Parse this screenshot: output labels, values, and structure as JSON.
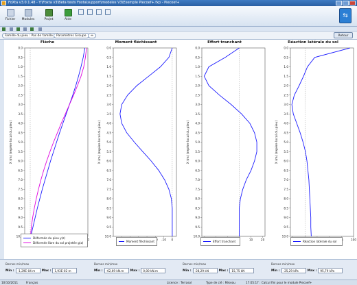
{
  "window": {
    "title": "FoXta v3.0.1.48 - Y:\\Foxta v3\\Beta tests Foxta\\support\\modeles V3\\Exemple Piecoef+.fxp - Piecoef+"
  },
  "ribbon": {
    "buttons": [
      {
        "label": "Fichier",
        "icon": "file-icon"
      },
      {
        "label": "Modules",
        "icon": "modules-icon"
      },
      {
        "label": "Projet",
        "icon": "project-icon"
      },
      {
        "label": "Aide",
        "icon": "help-icon"
      }
    ]
  },
  "toolbar": {
    "family_tag": "Famille du pieu : Pas de famille",
    "params_tag": "Paramètres Groupe",
    "back_label": "Retour"
  },
  "charts": {
    "depth_axis_label": "X (m) (repère local du pieu)",
    "depth_ticks": [
      "0.0",
      "0.5",
      "1.0",
      "1.5",
      "2.0",
      "2.5",
      "3.0",
      "3.5",
      "4.0",
      "4.5",
      "5.0",
      "5.5",
      "6.0",
      "6.5",
      "7.0",
      "7.5",
      "8.0",
      "8.5",
      "9.0",
      "9.5",
      "10.0"
    ]
  },
  "chart_data": [
    {
      "type": "line",
      "title": "Flèche",
      "xlabel": "Déplacement latéral (m)",
      "ylabel": "X (m) (repère local du pieu)",
      "xlim": [
        -0.002,
        0.021
      ],
      "ylim": [
        10.0,
        0.0
      ],
      "xticks": [
        "0.000",
        "0.005",
        "0.010",
        "0.015",
        "0.020"
      ],
      "series": [
        {
          "name": "Déformée du pieu y(z)",
          "color": "#1a1aff",
          "x": [
            0.0199,
            0.0193,
            0.0185,
            0.0176,
            0.0166,
            0.0155,
            0.0143,
            0.0131,
            0.0119,
            0.0107,
            0.0096,
            0.0085,
            0.0074,
            0.0064,
            0.0054,
            0.0044,
            0.0035,
            0.0026,
            0.0018,
            0.001,
            0.0002
          ],
          "y": [
            0.0,
            0.5,
            1.0,
            1.5,
            2.0,
            2.5,
            3.0,
            3.5,
            4.0,
            4.5,
            5.0,
            5.5,
            6.0,
            6.5,
            7.0,
            7.5,
            8.0,
            8.5,
            9.0,
            9.5,
            10.0
          ]
        },
        {
          "name": "Déformée libre du sol projetée g(z)",
          "color": "#e000e0",
          "x": [
            0.0205,
            0.0201,
            0.0195,
            0.0185,
            0.0172,
            0.0158,
            0.0143,
            0.0128,
            0.0113,
            0.0099,
            0.0085,
            0.0072,
            0.006,
            0.0049,
            0.0039,
            0.003,
            0.0022,
            0.0015,
            0.0009,
            0.0004,
            0.0001
          ],
          "y": [
            0.0,
            0.5,
            1.0,
            1.5,
            2.0,
            2.5,
            3.0,
            3.5,
            4.0,
            4.5,
            5.0,
            5.5,
            6.0,
            6.5,
            7.0,
            7.5,
            8.0,
            8.5,
            9.0,
            9.5,
            10.0
          ]
        }
      ]
    },
    {
      "type": "line",
      "title": "Moment fléchissant",
      "xlabel": "M (kN.m)",
      "ylabel": "X (m) (repère local du pieu)",
      "xlim": [
        -70,
        5
      ],
      "ylim": [
        10.0,
        0.0
      ],
      "xticks": [
        "-60",
        "-50",
        "-40",
        "-30",
        "-20",
        "-10",
        "0"
      ],
      "series": [
        {
          "name": "Moment fléchissant",
          "color": "#1a1aff",
          "x": [
            0,
            -4,
            -14,
            -28,
            -42,
            -53,
            -60,
            -62,
            -60,
            -54,
            -45,
            -35,
            -25,
            -16,
            -9,
            -4,
            -1,
            0,
            0,
            0,
            0
          ],
          "y": [
            0.0,
            0.5,
            1.0,
            1.5,
            2.0,
            2.5,
            3.0,
            3.5,
            4.0,
            4.5,
            5.0,
            5.5,
            6.0,
            6.5,
            7.0,
            7.5,
            8.0,
            8.5,
            9.0,
            9.5,
            10.0
          ]
        }
      ]
    },
    {
      "type": "line",
      "title": "Effort tranchant",
      "xlabel": "T (kN)",
      "ylabel": "X (m) (repère local du pieu)",
      "xlim": [
        -32,
        22
      ],
      "ylim": [
        10.0,
        0.0
      ],
      "xticks": [
        "-30",
        "-20",
        "-10",
        "0",
        "10",
        "20"
      ],
      "series": [
        {
          "name": "Effort tranchant",
          "color": "#1a1aff",
          "x": [
            0,
            -12,
            -26,
            -30,
            -26,
            -17,
            -7,
            2,
            9,
            13,
            15,
            15,
            13,
            10,
            6,
            3,
            1,
            0,
            0,
            0,
            0
          ],
          "y": [
            0.0,
            0.5,
            1.0,
            1.5,
            2.0,
            2.5,
            3.0,
            3.5,
            4.0,
            4.5,
            5.0,
            5.5,
            6.0,
            6.5,
            7.0,
            7.5,
            8.0,
            8.5,
            9.0,
            9.5,
            10.0
          ]
        }
      ]
    },
    {
      "type": "line",
      "title": "Réaction latérale du sol",
      "xlabel": "p (kPa)",
      "ylabel": "X (m) (repère local du pieu)",
      "xlim": [
        -30,
        100
      ],
      "ylim": [
        10.0,
        0.0
      ],
      "xticks": [
        "-25",
        "0",
        "25",
        "50",
        "75",
        "100"
      ],
      "series": [
        {
          "name": "Réaction latérale du sol",
          "color": "#1a1aff",
          "x": [
            93,
            20,
            5,
            -3,
            -12,
            -22,
            -27,
            -24,
            -17,
            -10,
            -4,
            1,
            4,
            6,
            8,
            9,
            10,
            11,
            12,
            12,
            13
          ],
          "y": [
            0.0,
            0.5,
            1.0,
            1.5,
            2.0,
            2.5,
            3.0,
            3.5,
            4.0,
            4.5,
            5.0,
            5.5,
            6.0,
            6.5,
            7.0,
            7.5,
            8.0,
            8.5,
            9.0,
            9.5,
            10.0
          ]
        }
      ]
    }
  ],
  "bounds": [
    {
      "title": "Bornes min/max",
      "min_label": "Min :",
      "min": "-1,29E-04 m",
      "max_label": "Max :",
      "max": "1,93E-02 m"
    },
    {
      "title": "Bornes min/max",
      "min_label": "Min :",
      "min": "-62,69 kN.m",
      "max_label": "Max :",
      "max": "0,00 kN.m"
    },
    {
      "title": "Bornes min/max",
      "min_label": "Min :",
      "min": "-28,29 kN",
      "max_label": "Max :",
      "max": "15,75 kN"
    },
    {
      "title": "Bornes min/max",
      "min_label": "Min :",
      "min": "-25,29 kPa",
      "max_label": "Max :",
      "max": "95,79 kPa"
    }
  ],
  "status": {
    "date": "10/10/2011",
    "language": "Français",
    "license": "Licence : Terrasol",
    "type": "Type de clé : Réseau",
    "message": "17:05:17 : Calcul fini pour le module Piecoef+"
  }
}
